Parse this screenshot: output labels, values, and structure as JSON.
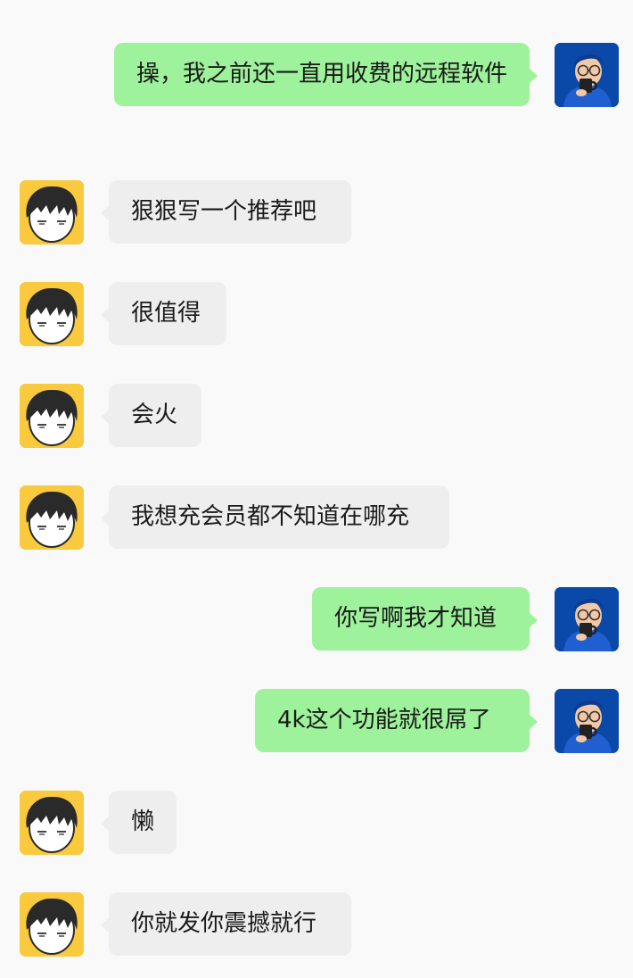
{
  "messages": [
    {
      "side": "right",
      "text": "操，我之前还一直用收费的远程软件"
    },
    {
      "side": "left",
      "text": "狠狠写一个推荐吧"
    },
    {
      "side": "left",
      "text": "很值得"
    },
    {
      "side": "left",
      "text": "会火"
    },
    {
      "side": "left",
      "text": "我想充会员都不知道在哪充"
    },
    {
      "side": "right",
      "text": "你写啊我才知道"
    },
    {
      "side": "right",
      "text": "4k这个功能就很屌了"
    },
    {
      "side": "left",
      "text": "懒"
    },
    {
      "side": "left",
      "text": "你就发你震撼就行"
    }
  ],
  "colors": {
    "background": "#f9f9f9",
    "sent_bubble": "#9df29b",
    "received_bubble": "#eeeeef",
    "received_avatar_bg": "#f9c93e",
    "sent_avatar_bg": "#0b49a8"
  },
  "icons": {
    "sent_avatar": "avatar-3d-man-with-mug-icon",
    "received_avatar": "avatar-cartoon-face-icon"
  }
}
